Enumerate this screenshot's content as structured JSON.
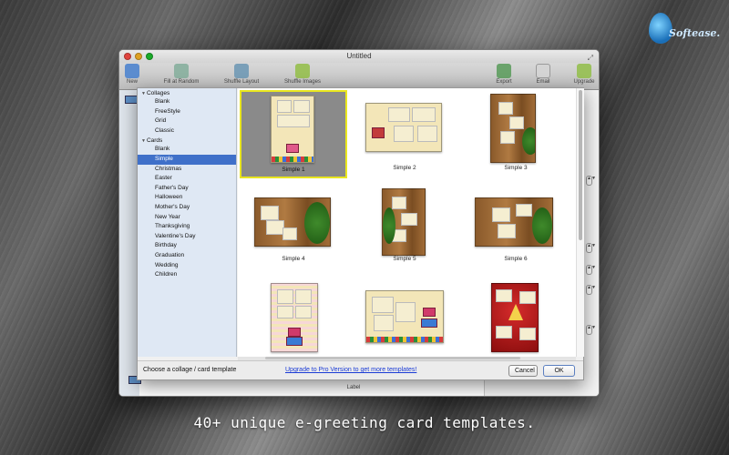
{
  "brand": {
    "name": "Softease."
  },
  "window": {
    "title": "Untitled",
    "toolbar": {
      "new": "New",
      "fill_random": "Fill at Random",
      "shuffle_layout": "Shuffle Layout",
      "shuffle_images": "Shuffle Images",
      "export": "Export",
      "email": "Email",
      "upgrade": "Upgrade"
    },
    "bottom_label": "Label"
  },
  "sheet": {
    "sidebar": {
      "groups": [
        {
          "label": "Collages",
          "items": [
            "Blank",
            "FreeStyle",
            "Grid",
            "Classic"
          ]
        },
        {
          "label": "Cards",
          "items": [
            "Blank",
            "Simple",
            "Christmas",
            "Easter",
            "Father's Day",
            "Halloween",
            "Mother's Day",
            "New Year",
            "Thanksgiving",
            "Valentine's Day",
            "Birthday",
            "Graduation",
            "Wedding",
            "Children"
          ]
        }
      ],
      "selected": "Simple"
    },
    "templates": [
      "Simple 1",
      "Simple 2",
      "Simple 3",
      "Simple 4",
      "Simple 5",
      "Simple 6"
    ],
    "selected_template": "Simple 1",
    "footer": {
      "label": "Choose a collage / card template",
      "upgrade_link": "Upgrade to Pro Version to get more templates!",
      "cancel": "Cancel",
      "ok": "OK"
    }
  },
  "caption": "40+ unique e-greeting card templates.",
  "colors": {
    "selection": "#3f70c9",
    "selected_tile_border": "#e9e61f",
    "link": "#1a3bd6"
  }
}
